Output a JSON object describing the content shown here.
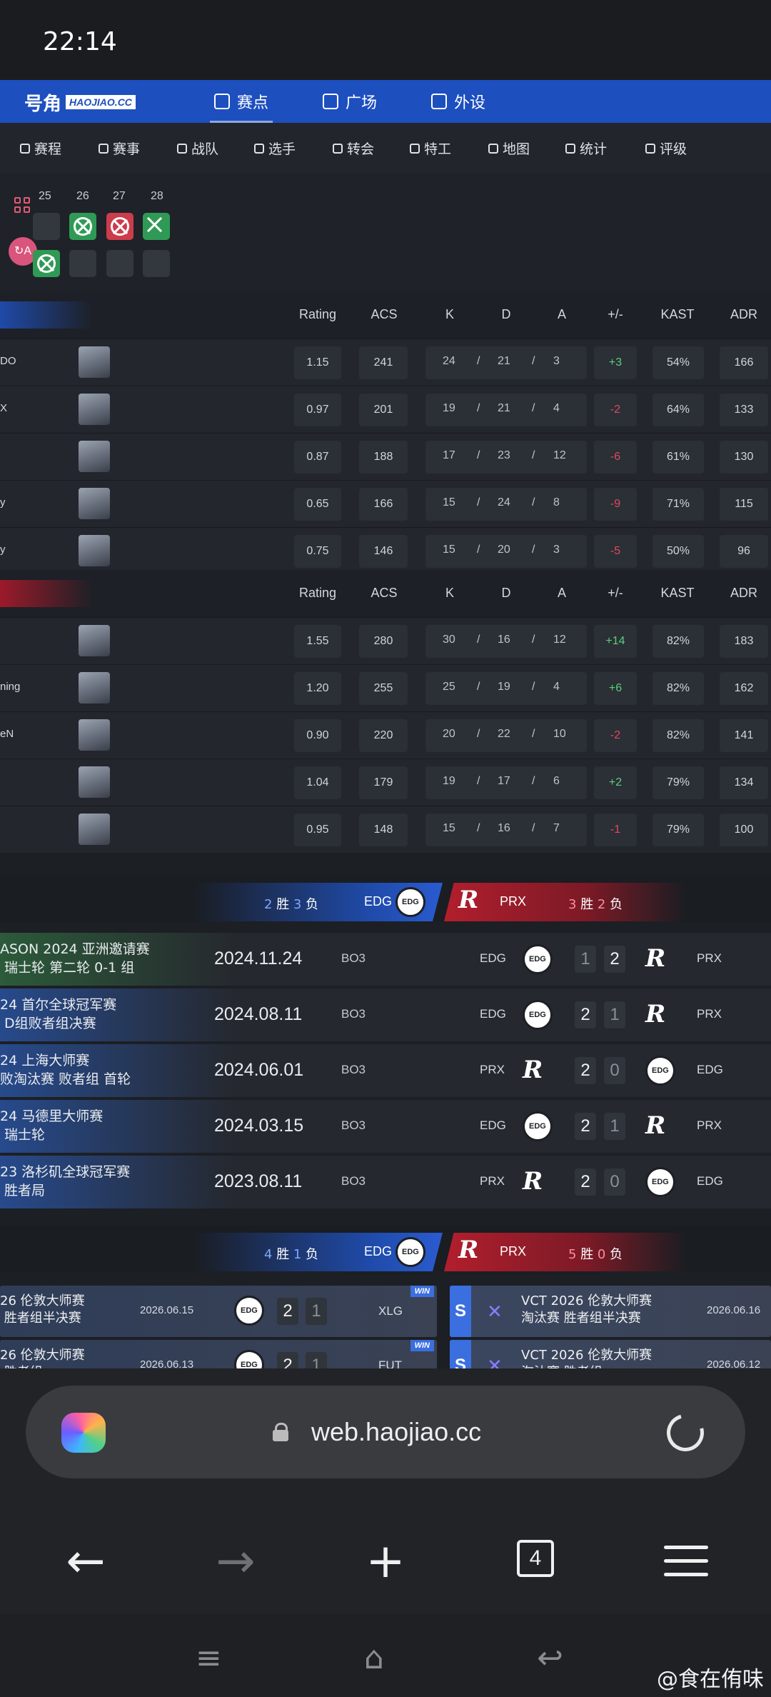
{
  "status_bar": {
    "time": "22:14"
  },
  "brand": {
    "name_cn": "号角",
    "name_en": "HAOJIAO.CC"
  },
  "nav_tabs": [
    {
      "label": "赛点",
      "icon": "heart-icon"
    },
    {
      "label": "广场",
      "icon": "chat-icon"
    },
    {
      "label": "外设",
      "icon": "device-icon"
    }
  ],
  "sub_nav": [
    {
      "label": "赛程",
      "icon": "check-icon"
    },
    {
      "label": "赛事",
      "icon": "trophy-icon"
    },
    {
      "label": "战队",
      "icon": "flag-icon"
    },
    {
      "label": "选手",
      "icon": "crossed-swords-icon"
    },
    {
      "label": "转会",
      "icon": "transfer-icon"
    },
    {
      "label": "特工",
      "icon": "agent-mask-icon"
    },
    {
      "label": "地图",
      "icon": "map-icon"
    },
    {
      "label": "统计",
      "icon": "bar-chart-icon"
    },
    {
      "label": "评级",
      "icon": "rating-check-icon"
    }
  ],
  "map_days": [
    "25",
    "26",
    "27",
    "28"
  ],
  "stat_headers": [
    "Rating",
    "ACS",
    "K",
    "D",
    "A",
    "+/-",
    "KAST",
    "ADR"
  ],
  "team1_players": [
    {
      "name": "DO",
      "rating": "1.15",
      "acs": "241",
      "k": "24",
      "d": "21",
      "a": "3",
      "pm": "+3",
      "kast": "54%",
      "adr": "166"
    },
    {
      "name": "X",
      "rating": "0.97",
      "acs": "201",
      "k": "19",
      "d": "21",
      "a": "4",
      "pm": "-2",
      "kast": "64%",
      "adr": "133"
    },
    {
      "name": "",
      "rating": "0.87",
      "acs": "188",
      "k": "17",
      "d": "23",
      "a": "12",
      "pm": "-6",
      "kast": "61%",
      "adr": "130"
    },
    {
      "name": "y",
      "rating": "0.65",
      "acs": "166",
      "k": "15",
      "d": "24",
      "a": "8",
      "pm": "-9",
      "kast": "71%",
      "adr": "115"
    },
    {
      "name": "y",
      "rating": "0.75",
      "acs": "146",
      "k": "15",
      "d": "20",
      "a": "3",
      "pm": "-5",
      "kast": "50%",
      "adr": "96"
    }
  ],
  "team2_players": [
    {
      "name": "",
      "rating": "1.55",
      "acs": "280",
      "k": "30",
      "d": "16",
      "a": "12",
      "pm": "+14",
      "kast": "82%",
      "adr": "183"
    },
    {
      "name": "ning",
      "rating": "1.20",
      "acs": "255",
      "k": "25",
      "d": "19",
      "a": "4",
      "pm": "+6",
      "kast": "82%",
      "adr": "162"
    },
    {
      "name": "eN",
      "rating": "0.90",
      "acs": "220",
      "k": "20",
      "d": "22",
      "a": "10",
      "pm": "-2",
      "kast": "82%",
      "adr": "141"
    },
    {
      "name": "",
      "rating": "1.04",
      "acs": "179",
      "k": "19",
      "d": "17",
      "a": "6",
      "pm": "+2",
      "kast": "79%",
      "adr": "134"
    },
    {
      "name": "",
      "rating": "0.95",
      "acs": "148",
      "k": "15",
      "d": "16",
      "a": "7",
      "pm": "-1",
      "kast": "79%",
      "adr": "100"
    }
  ],
  "h2h": {
    "left": {
      "wins": "2",
      "win_label": "胜",
      "losses": "3",
      "loss_label": "负",
      "team": "EDG",
      "logo": "EDG"
    },
    "right": {
      "team": "PRX",
      "logo": "R",
      "wins": "3",
      "win_label": "胜",
      "losses": "2",
      "loss_label": "负"
    },
    "matches": [
      {
        "event": "ASON 2024 亚洲邀请赛\n 瑞士轮 第二轮 0-1 组",
        "date": "2024.11.24",
        "bo": "BO3",
        "team_a": "EDG",
        "score_a": "1",
        "score_b": "2",
        "team_b": "PRX"
      },
      {
        "event": "24 首尔全球冠军赛\n D组败者组决赛",
        "date": "2024.08.11",
        "bo": "BO3",
        "team_a": "EDG",
        "score_a": "2",
        "score_b": "1",
        "team_b": "PRX"
      },
      {
        "event": "24 上海大师赛\n败淘汰赛 败者组 首轮",
        "date": "2024.06.01",
        "bo": "BO3",
        "team_a": "PRX",
        "score_a": "2",
        "score_b": "0",
        "team_b": "EDG"
      },
      {
        "event": "24 马德里大师赛\n 瑞士轮",
        "date": "2024.03.15",
        "bo": "BO3",
        "team_a": "EDG",
        "score_a": "2",
        "score_b": "1",
        "team_b": "PRX"
      },
      {
        "event": "23 洛杉矶全球冠军赛\n 胜者局",
        "date": "2023.08.11",
        "bo": "BO3",
        "team_a": "PRX",
        "score_a": "2",
        "score_b": "0",
        "team_b": "EDG"
      }
    ]
  },
  "recent": {
    "left": {
      "wins": "4",
      "win_label": "胜",
      "losses": "1",
      "loss_label": "负",
      "team": "EDG",
      "logo": "EDG"
    },
    "right": {
      "team": "PRX",
      "logo": "R",
      "wins": "5",
      "win_label": "胜",
      "losses": "0",
      "loss_label": "负"
    },
    "left_matches": [
      {
        "event": "26 伦敦大师赛\n 胜者组半决赛",
        "date": "2026.06.15",
        "score_a": "2",
        "score_b": "1",
        "opponent": "XLG",
        "badge": "WIN"
      },
      {
        "event": "26 伦敦大师赛\n 胜者组...",
        "date": "2026.06.13",
        "score_a": "2",
        "score_b": "1",
        "opponent": "FUT",
        "badge": "WIN"
      }
    ],
    "right_matches": [
      {
        "badge": "S",
        "event": "VCT 2026 伦敦大师赛\n淘汰赛 胜者组半决赛",
        "date": "2026.06.16"
      },
      {
        "badge": "S",
        "event": "VCT 2026 伦敦大师赛\n淘汰赛 胜者组...",
        "date": "2026.06.12"
      }
    ]
  },
  "browser": {
    "url": "web.haojiao.cc",
    "tab_count": "4"
  },
  "watermark": "@食在侑味",
  "colors": {
    "brand_blue": "#1d4fbf",
    "win_green": "#2f9a55",
    "loss_red": "#cc3c4b",
    "positive": "#5ad07a",
    "negative": "#e0495e"
  }
}
